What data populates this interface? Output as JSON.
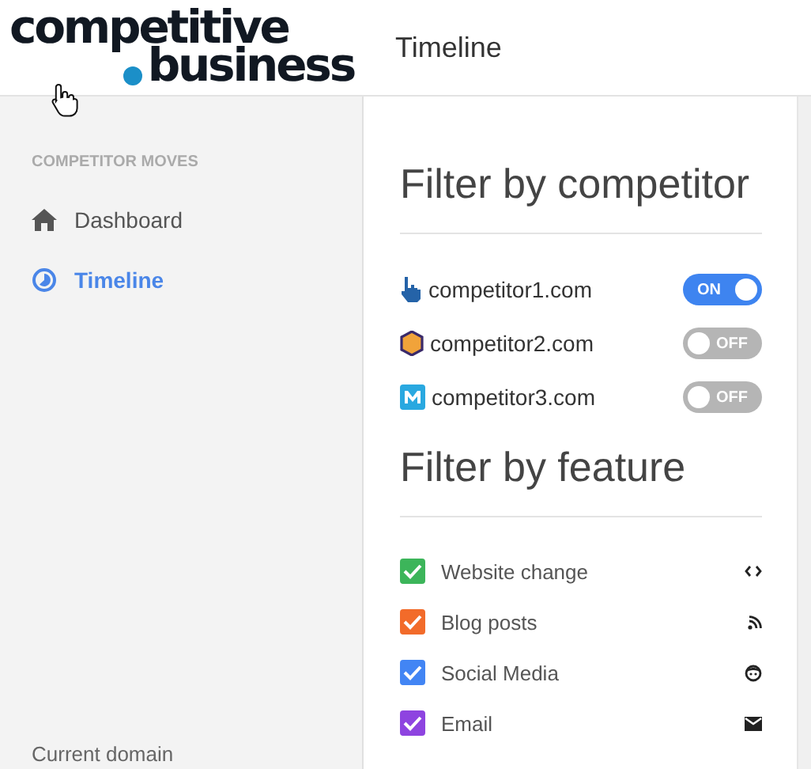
{
  "logo": {
    "line_1": "competitive",
    "line_2": "business"
  },
  "header": {
    "title": "Timeline"
  },
  "sidebar": {
    "section_label": "COMPETITOR MOVES",
    "items": [
      {
        "label": "Dashboard",
        "kind": "home",
        "selected": false
      },
      {
        "label": "Timeline",
        "kind": "timeline",
        "selected": true
      }
    ],
    "footer_label": "Current domain"
  },
  "competitor_filter": {
    "heading": "Filter by competitor",
    "items": [
      {
        "domain": "competitor1.com",
        "kind": "pointer",
        "on": true,
        "toggle_label": "ON"
      },
      {
        "domain": "competitor2.com",
        "kind": "hexagon",
        "on": false,
        "toggle_label": "OFF"
      },
      {
        "domain": "competitor3.com",
        "kind": "m",
        "on": false,
        "toggle_label": "OFF"
      }
    ]
  },
  "feature_filter": {
    "heading": "Filter by feature",
    "items": [
      {
        "label": "Website change",
        "checked": true,
        "color": "#3cb55a",
        "kind": "code"
      },
      {
        "label": "Blog posts",
        "checked": true,
        "color": "#f26b2a",
        "kind": "rss"
      },
      {
        "label": "Social Media",
        "checked": true,
        "color": "#4285f4",
        "kind": "face"
      },
      {
        "label": "Email",
        "checked": true,
        "color": "#8e44e0",
        "kind": "mail"
      }
    ]
  }
}
